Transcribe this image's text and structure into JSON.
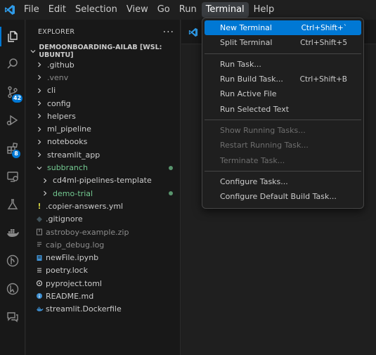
{
  "menubar": {
    "items": [
      "File",
      "Edit",
      "Selection",
      "View",
      "Go",
      "Run",
      "Terminal",
      "Help"
    ],
    "open_index": 6
  },
  "activity_bar": {
    "icons": [
      "explorer-icon",
      "search-icon",
      "source-control-icon",
      "run-debug-icon",
      "extensions-icon",
      "remote-explorer-icon",
      "testing-icon",
      "docker-icon",
      "git-graph-icon",
      "remote-status-icon",
      "chat-icon"
    ],
    "badges": {
      "source_control": "42",
      "extensions": "8"
    }
  },
  "sidebar": {
    "title": "EXPLORER",
    "more": "···",
    "workspace": "DEMOONBOARDING-AILAB [WSL: UBUNTU]",
    "items": [
      {
        "label": ".github",
        "kind": "folder",
        "state": "normal"
      },
      {
        "label": ".venv",
        "kind": "folder",
        "state": "dim"
      },
      {
        "label": "cli",
        "kind": "folder",
        "state": "normal"
      },
      {
        "label": "config",
        "kind": "folder",
        "state": "normal"
      },
      {
        "label": "helpers",
        "kind": "folder",
        "state": "normal"
      },
      {
        "label": "ml_pipeline",
        "kind": "folder",
        "state": "normal"
      },
      {
        "label": "notebooks",
        "kind": "folder",
        "state": "normal"
      },
      {
        "label": "streamlit_app",
        "kind": "folder",
        "state": "normal"
      },
      {
        "label": "subbranch",
        "kind": "folder-open",
        "state": "green"
      },
      {
        "label": "cd4ml-pipelines-template",
        "kind": "folder-nested",
        "state": "normal"
      },
      {
        "label": "demo-trial",
        "kind": "folder-nested",
        "state": "green"
      },
      {
        "label": ".copier-answers.yml",
        "kind": "file-yml",
        "state": "normal"
      },
      {
        "label": ".gitignore",
        "kind": "file-git",
        "state": "normal"
      },
      {
        "label": "astroboy-example.zip",
        "kind": "file-zip",
        "state": "dim"
      },
      {
        "label": "caip_debug.log",
        "kind": "file-log",
        "state": "dim"
      },
      {
        "label": "newFile.ipynb",
        "kind": "file-ipynb",
        "state": "normal"
      },
      {
        "label": "poetry.lock",
        "kind": "file-lock",
        "state": "normal"
      },
      {
        "label": "pyproject.toml",
        "kind": "file-toml",
        "state": "normal"
      },
      {
        "label": "README.md",
        "kind": "file-md",
        "state": "normal"
      },
      {
        "label": "streamlit.Dockerfile",
        "kind": "file-docker",
        "state": "normal"
      }
    ]
  },
  "terminal_menu": {
    "groups": [
      [
        {
          "label": "New Terminal",
          "shortcut": "Ctrl+Shift+`",
          "state": "selected"
        },
        {
          "label": "Split Terminal",
          "shortcut": "Ctrl+Shift+5",
          "state": "normal"
        }
      ],
      [
        {
          "label": "Run Task...",
          "shortcut": "",
          "state": "normal"
        },
        {
          "label": "Run Build Task...",
          "shortcut": "Ctrl+Shift+B",
          "state": "normal"
        },
        {
          "label": "Run Active File",
          "shortcut": "",
          "state": "normal"
        },
        {
          "label": "Run Selected Text",
          "shortcut": "",
          "state": "normal"
        }
      ],
      [
        {
          "label": "Show Running Tasks...",
          "shortcut": "",
          "state": "disabled"
        },
        {
          "label": "Restart Running Task...",
          "shortcut": "",
          "state": "disabled"
        },
        {
          "label": "Terminate Task...",
          "shortcut": "",
          "state": "disabled"
        }
      ],
      [
        {
          "label": "Configure Tasks...",
          "shortcut": "",
          "state": "normal"
        },
        {
          "label": "Configure Default Build Task...",
          "shortcut": "",
          "state": "normal"
        }
      ]
    ]
  },
  "colors": {
    "accent": "#0078d4",
    "git_added": "#73c991",
    "yml": "#cbcb41",
    "python": "#3d8fd1",
    "docker": "#3d8fd1"
  }
}
